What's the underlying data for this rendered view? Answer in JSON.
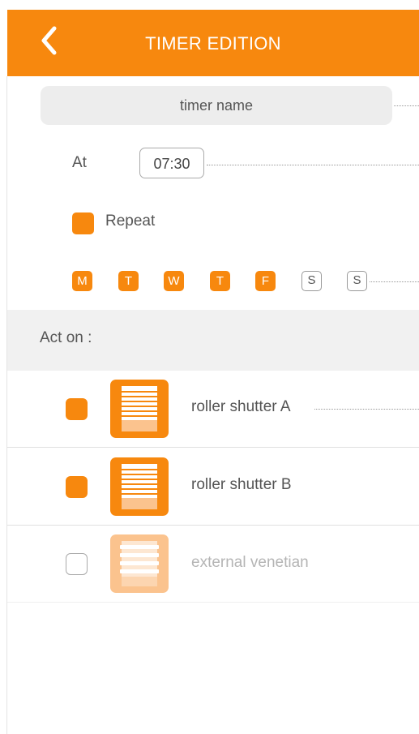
{
  "header": {
    "title": "TIMER EDITION"
  },
  "form": {
    "name_placeholder": "timer name",
    "at_label": "At",
    "time_value": "07:30",
    "repeat_label": "Repeat",
    "days": [
      {
        "letter": "M",
        "selected": true
      },
      {
        "letter": "T",
        "selected": true
      },
      {
        "letter": "W",
        "selected": true
      },
      {
        "letter": "T",
        "selected": true
      },
      {
        "letter": "F",
        "selected": true
      },
      {
        "letter": "S",
        "selected": false
      },
      {
        "letter": "S",
        "selected": false
      }
    ]
  },
  "act_on": {
    "label": "Act on :",
    "devices": [
      {
        "name": "roller shutter A",
        "checked": true,
        "icon": "roller-shutter-icon"
      },
      {
        "name": "roller shutter B",
        "checked": true,
        "icon": "roller-shutter-icon"
      },
      {
        "name": "external venetian",
        "checked": false,
        "icon": "venetian-blind-icon"
      }
    ]
  },
  "colors": {
    "accent": "#f7880e",
    "accent_light": "#fbc38e",
    "text": "#555555",
    "muted": "#b5b5b5"
  }
}
